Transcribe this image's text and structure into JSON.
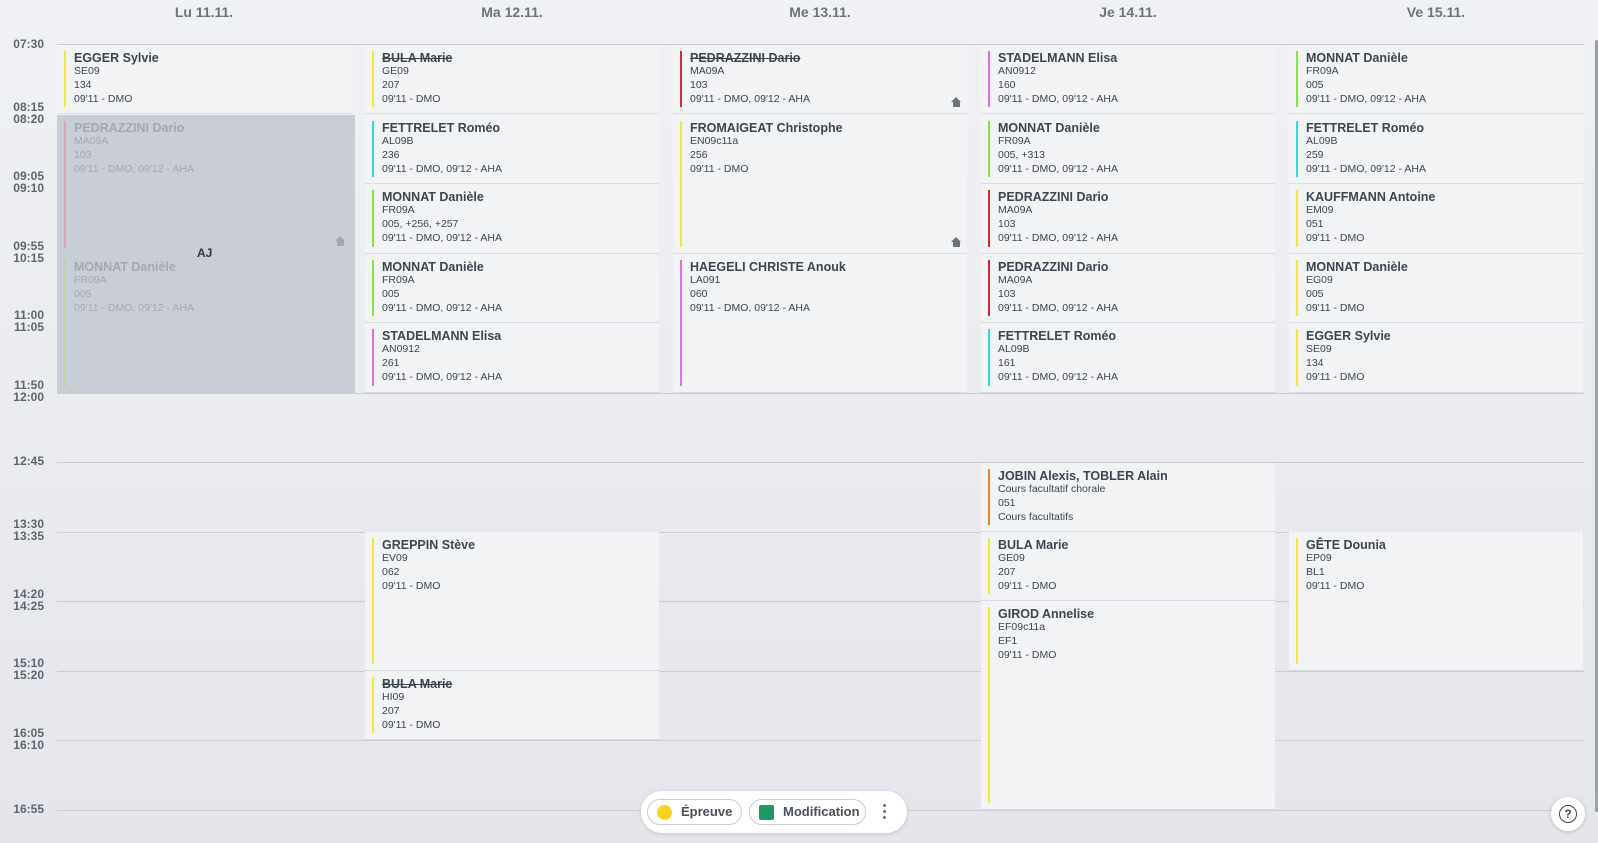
{
  "days": [
    "Lu 11.11.",
    "Ma 12.11.",
    "Me 13.11.",
    "Je 14.11.",
    "Ve 15.11."
  ],
  "times": [
    "07:30",
    "08:15",
    "08:20",
    "09:05",
    "09:10",
    "09:55",
    "10:15",
    "11:00",
    "11:05",
    "11:50",
    "12:00",
    "12:45",
    "13:30",
    "13:35",
    "14:20",
    "14:25",
    "15:10",
    "15:20",
    "16:05",
    "16:10",
    "16:55"
  ],
  "colors": {
    "yellow": "#f3e934",
    "cyan": "#2fd6e8",
    "lime": "#86e43a",
    "magenta": "#e36be8",
    "red": "#e0262d",
    "orange": "#f07f25",
    "dim_red": "#d9a7ad",
    "dim_green": "#b9d4a6"
  },
  "shaded_label": "AJ",
  "events": [
    {
      "title": "EGGER Sylvie",
      "sub": "SE09",
      "lines": [
        "134",
        "09'11 - DMO"
      ]
    },
    {
      "title": "PEDRAZZINI Dario",
      "sub": "MA09A",
      "lines": [
        "103",
        "09'11 - DMO, 09'12 - AHA"
      ]
    },
    {
      "title": "MONNAT Danièle",
      "sub": "FR09A",
      "lines": [
        "005",
        "09'11 - DMO, 09'12 - AHA"
      ]
    },
    {
      "title": "BULA Marie",
      "sub": "GE09",
      "lines": [
        "207",
        "09'11 - DMO"
      ]
    },
    {
      "title": "FETTRELET Roméo",
      "sub": "AL09B",
      "lines": [
        "236",
        "09'11 - DMO, 09'12 - AHA"
      ]
    },
    {
      "title": "MONNAT Danièle",
      "sub": "FR09A",
      "lines": [
        "005, +256, +257",
        "09'11 - DMO, 09'12 - AHA"
      ]
    },
    {
      "title": "MONNAT Danièle",
      "sub": "FR09A",
      "lines": [
        "005",
        "09'11 - DMO, 09'12 - AHA"
      ]
    },
    {
      "title": "STADELMANN Elisa",
      "sub": "AN0912",
      "lines": [
        "261",
        "09'11 - DMO, 09'12 - AHA"
      ]
    },
    {
      "title": "GREPPIN Stève",
      "sub": "EV09",
      "lines": [
        "062",
        "09'11 - DMO"
      ]
    },
    {
      "title": "BULA Marie",
      "sub": "HI09",
      "lines": [
        "207",
        "09'11 - DMO"
      ]
    },
    {
      "title": "PEDRAZZINI Dario",
      "sub": "MA09A",
      "lines": [
        "103",
        "09'11 - DMO, 09'12 - AHA"
      ]
    },
    {
      "title": "FROMAIGEAT Christophe",
      "sub": "EN09c11a",
      "lines": [
        "256",
        "09'11 - DMO"
      ]
    },
    {
      "title": "HAEGELI CHRISTE Anouk",
      "sub": "LA091",
      "lines": [
        "060",
        "09'11 - DMO, 09'12 - AHA"
      ]
    },
    {
      "title": "STADELMANN Elisa",
      "sub": "AN0912",
      "lines": [
        "160",
        "09'11 - DMO, 09'12 - AHA"
      ]
    },
    {
      "title": "MONNAT Danièle",
      "sub": "FR09A",
      "lines": [
        "005, +313",
        "09'11 - DMO, 09'12 - AHA"
      ]
    },
    {
      "title": "PEDRAZZINI Dario",
      "sub": "MA09A",
      "lines": [
        "103",
        "09'11 - DMO, 09'12 - AHA"
      ]
    },
    {
      "title": "PEDRAZZINI Dario",
      "sub": "MA09A",
      "lines": [
        "103",
        "09'11 - DMO, 09'12 - AHA"
      ]
    },
    {
      "title": "FETTRELET Roméo",
      "sub": "AL09B",
      "lines": [
        "161",
        "09'11 - DMO, 09'12 - AHA"
      ]
    },
    {
      "title": "JOBIN Alexis, TOBLER Alain",
      "sub": "Cours facultatif chorale",
      "lines": [
        "051",
        "Cours facultatifs"
      ]
    },
    {
      "title": "BULA Marie",
      "sub": "GE09",
      "lines": [
        "207",
        "09'11 - DMO"
      ]
    },
    {
      "title": "GIROD Annelise",
      "sub": "EF09c11a",
      "lines": [
        "EF1",
        "09'11 - DMO"
      ]
    },
    {
      "title": "MONNAT Danièle",
      "sub": "FR09A",
      "lines": [
        "005",
        "09'11 - DMO, 09'12 - AHA"
      ]
    },
    {
      "title": "FETTRELET Roméo",
      "sub": "AL09B",
      "lines": [
        "259",
        "09'11 - DMO, 09'12 - AHA"
      ]
    },
    {
      "title": "KAUFFMANN Antoine",
      "sub": "EM09",
      "lines": [
        "051",
        "09'11 - DMO"
      ]
    },
    {
      "title": "MONNAT Danièle",
      "sub": "EG09",
      "lines": [
        "005",
        "09'11 - DMO"
      ]
    },
    {
      "title": "EGGER Sylvie",
      "sub": "SE09",
      "lines": [
        "134",
        "09'11 - DMO"
      ]
    },
    {
      "title": "GÊTE Dounia",
      "sub": "EP09",
      "lines": [
        "BL1",
        "09'11 - DMO"
      ]
    }
  ],
  "legend": {
    "exam_label": "Épreuve",
    "exam_color": "#f8d21f",
    "change_label": "Modification",
    "change_color": "#1e9a62"
  },
  "help_label": "?"
}
